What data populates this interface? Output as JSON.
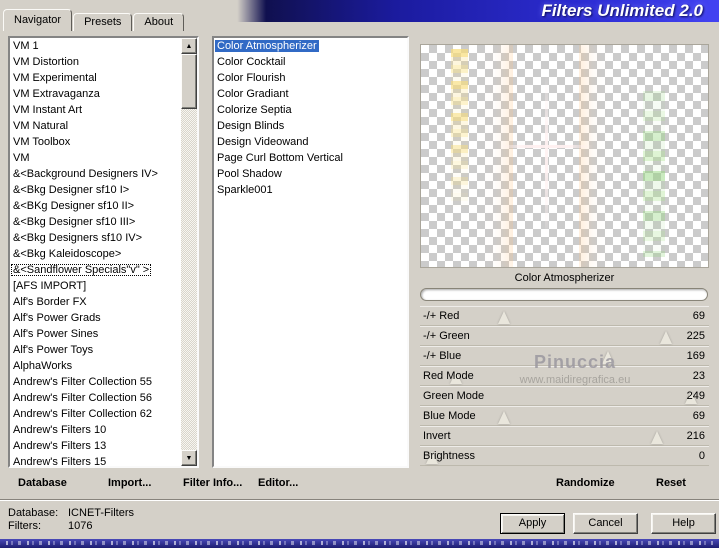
{
  "banner": {
    "title": "Filters Unlimited 2.0"
  },
  "tabs": {
    "active_index": 0,
    "items": [
      "Navigator",
      "Presets",
      "About"
    ]
  },
  "category_list": {
    "selected_index": 14,
    "items": [
      "VM 1",
      "VM Distortion",
      "VM Experimental",
      "VM Extravaganza",
      "VM Instant Art",
      "VM Natural",
      "VM Toolbox",
      "VM",
      "&<Background Designers IV>",
      "&<Bkg Designer sf10 I>",
      "&<BKg Designer sf10 II>",
      "&<Bkg Designer sf10 III>",
      "&<Bkg Designers sf10 IV>",
      "&<Bkg Kaleidoscope>",
      "&<Sandflower Specials\"v\" >",
      "[AFS IMPORT]",
      "Alf's Border FX",
      "Alf's Power Grads",
      "Alf's Power Sines",
      "Alf's Power Toys",
      "AlphaWorks",
      "Andrew's Filter Collection 55",
      "Andrew's Filter Collection 56",
      "Andrew's Filter Collection 62",
      "Andrew's Filters 10",
      "Andrew's Filters 13",
      "Andrew's Filters 15"
    ]
  },
  "filter_list": {
    "selected_index": 0,
    "items": [
      "Color Atmospherizer",
      "Color Cocktail",
      "Color Flourish",
      "Color Gradiant",
      "Colorize Septia",
      "Design Blinds",
      "Design Videowand",
      "Page Curl Bottom Vertical",
      "Pool Shadow",
      "Sparkle001"
    ]
  },
  "preview": {
    "caption": "Color Atmospherizer"
  },
  "sliders": [
    {
      "label": "-/+ Red",
      "value": 69
    },
    {
      "label": "-/+ Green",
      "value": 225
    },
    {
      "label": "-/+ Blue",
      "value": 169
    },
    {
      "label": "Red Mode",
      "value": 23
    },
    {
      "label": "Green Mode",
      "value": 249
    },
    {
      "label": "Blue Mode",
      "value": 69
    },
    {
      "label": "Invert",
      "value": 216
    },
    {
      "label": "Brightness",
      "value": 0
    }
  ],
  "watermark": {
    "line1": "Pinuccia",
    "line2": "www.maidiregrafica.eu"
  },
  "actions": {
    "database": "Database",
    "import": "Import...",
    "filter_info": "Filter Info...",
    "editor": "Editor...",
    "randomize": "Randomize",
    "reset": "Reset"
  },
  "status": {
    "database_label": "Database:",
    "database_value": "ICNET-Filters",
    "filters_label": "Filters:",
    "filters_value": "1076"
  },
  "dialog_buttons": {
    "apply": "Apply",
    "cancel": "Cancel",
    "help": "Help"
  },
  "colors": {
    "dialog_bg": "#d4d0c8",
    "selection_blue": "#316ac5",
    "banner_blue": "#2d2dd4"
  }
}
